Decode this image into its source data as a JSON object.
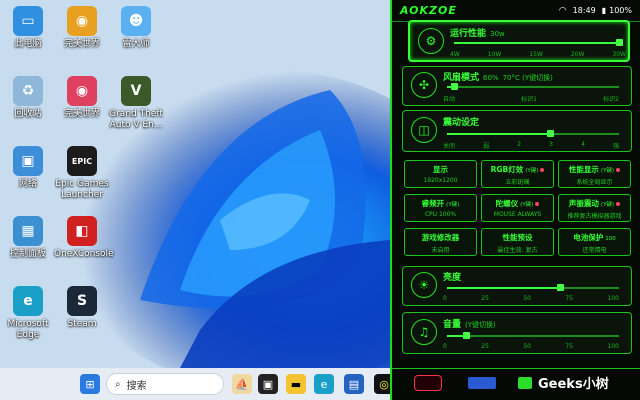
{
  "desktop": {
    "icons": [
      {
        "label": "此电脑",
        "glyph": "▭",
        "color": "#2f8fe0"
      },
      {
        "label": "完美世界",
        "glyph": "◉",
        "color": "#e8a020"
      },
      {
        "label": "雷大师",
        "glyph": "☻",
        "color": "#5ab0f0"
      },
      {
        "label": "回收站",
        "glyph": "♻",
        "color": "#8fb7d9"
      },
      {
        "label": "完美世界",
        "glyph": "◉",
        "color": "#e04060"
      },
      {
        "label": "Grand Theft Auto V En...",
        "glyph": "V",
        "color": "#3a5a2a"
      },
      {
        "label": "网络",
        "glyph": "▣",
        "color": "#3c8ed8"
      },
      {
        "label": "Epic Games Launcher",
        "glyph": "EPIC",
        "color": "#1c1c1c"
      },
      {
        "label": "控制面板",
        "glyph": "▦",
        "color": "#3a90d0"
      },
      {
        "label": "OneXConsole",
        "glyph": "◧",
        "color": "#d02020"
      },
      {
        "label": "Microsoft Edge",
        "glyph": "e",
        "color": "#1aa0c8"
      },
      {
        "label": "Steam",
        "glyph": "S",
        "color": "#1b2838"
      }
    ]
  },
  "taskbar": {
    "search_placeholder": "搜索",
    "items": [
      "windows-start",
      "search",
      "news",
      "taskview",
      "explorer",
      "edge",
      "store",
      "game"
    ]
  },
  "panel": {
    "brand": "AOKZOE",
    "time": "18:49",
    "battery": "100%",
    "performance": {
      "title": "运行性能",
      "value": "30w",
      "ticks": [
        "4W",
        "10W",
        "15W",
        "20W",
        "30W"
      ],
      "level": 1.0
    },
    "fan": {
      "title": "风扇模式",
      "value": "60%",
      "note": "70°C (Y键切换)",
      "labels": [
        "自动",
        "标识1",
        "标识2"
      ],
      "level": 0.04
    },
    "vibration": {
      "title": "震动设定",
      "labels": [
        "关闭",
        "弱",
        "2",
        "3",
        "4",
        "强"
      ],
      "level": 0.6
    },
    "tiles": [
      {
        "t1": "显示",
        "t2": "1920x1200",
        "dot": ""
      },
      {
        "t1": "RGB灯效",
        "t1b": "(Y键)",
        "t2": "五彩斑斓",
        "dot": "#ff4060"
      },
      {
        "t1": "性能显示",
        "t1b": "(Y键)",
        "t2": "系统全局显示",
        "dot": "#ff4060"
      },
      {
        "t1": "睿频开",
        "t1b": "(Y键)",
        "t2": "CPU 100%",
        "dot": ""
      },
      {
        "t1": "陀螺仪",
        "t1b": "(Y键)",
        "t2": "MOUSE ALWAYS",
        "dot": "#ff4060"
      },
      {
        "t1": "声振震动",
        "t1b": "(Y键)",
        "t2": "推荐复古模拟器游戏",
        "dot": "#ff4060"
      },
      {
        "t1": "游戏修改器",
        "t2": "未启用",
        "dot": ""
      },
      {
        "t1": "性能预设",
        "t2": "最佳生效: 复古",
        "dot": ""
      },
      {
        "t1": "电池保护",
        "t1b": "100",
        "t2": "还常情电",
        "dot": ""
      }
    ],
    "brightness": {
      "title": "亮度",
      "ticks": [
        "0",
        "25",
        "50",
        "75",
        "100"
      ],
      "level": 0.65
    },
    "volume": {
      "title": "音量",
      "note": "(Y键切换)",
      "ticks": [
        "0",
        "25",
        "50",
        "75",
        "100"
      ],
      "level": 0.1
    }
  },
  "watermark": "Geeks小树"
}
